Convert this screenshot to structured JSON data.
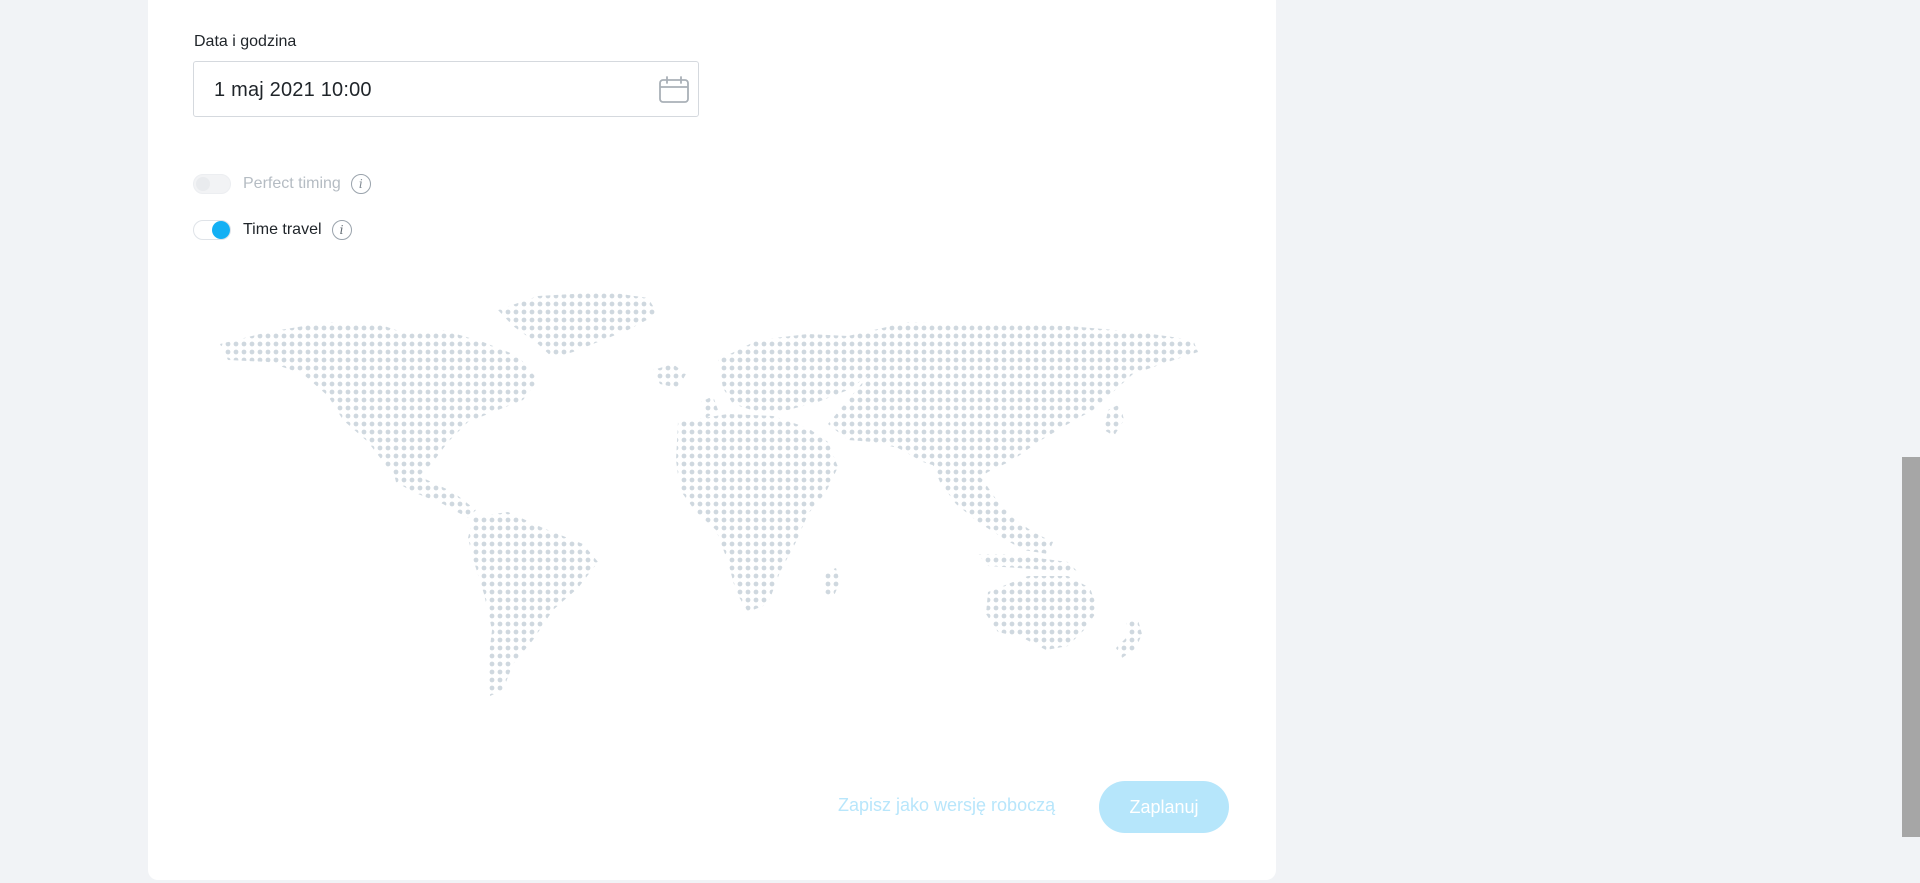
{
  "schedule": {
    "datetime_label": "Data i godzina",
    "datetime_value": "1 maj 2021 10:00",
    "calendar_icon": "calendar-icon"
  },
  "options": {
    "perfect_timing": {
      "label": "Perfect timing",
      "enabled": false,
      "disabled": true
    },
    "time_travel": {
      "label": "Time travel",
      "enabled": true
    }
  },
  "map": {
    "dot_color": "#cfd8df"
  },
  "actions": {
    "save_draft_label": "Zapisz jako wersję roboczą",
    "schedule_label": "Zaplanuj"
  },
  "colors": {
    "accent": "#13b0f4",
    "button_disabled": "#b6e6fb"
  }
}
